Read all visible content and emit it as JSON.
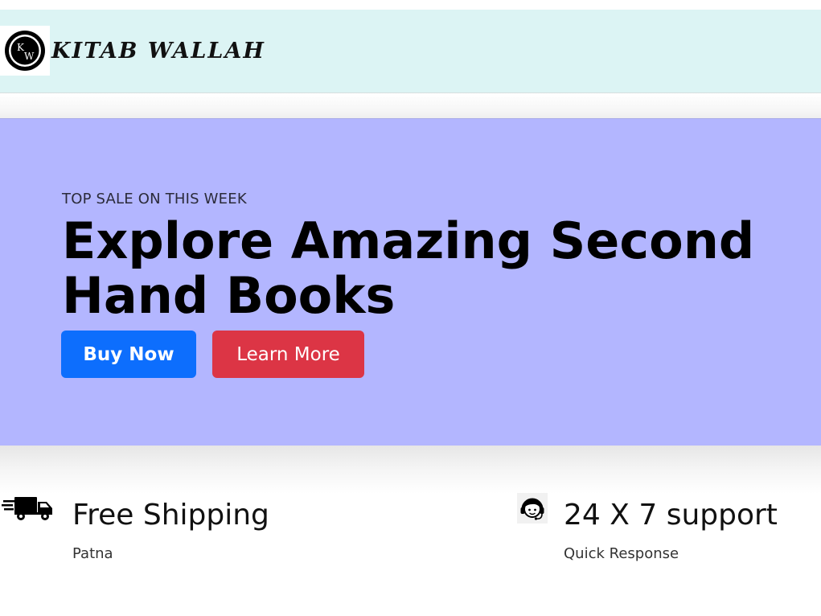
{
  "brand": {
    "name": "KITAB WALLAH",
    "logo_letters": [
      "K",
      "W"
    ]
  },
  "hero": {
    "kicker": "TOP SALE ON THIS WEEK",
    "title": "Explore Amazing Second Hand Books",
    "buttons": {
      "buy_label": "Buy Now",
      "learn_label": "Learn More"
    },
    "background": "#b3b6ff"
  },
  "features": [
    {
      "icon": "delivery-truck-icon",
      "title": "Free Shipping",
      "subtitle": "Patna"
    },
    {
      "icon": "support-agent-icon",
      "title": "24 X 7 support",
      "subtitle": "Quick Response"
    }
  ],
  "colors": {
    "navbar_bg": "#dcf4f4",
    "primary": "#0d6efd",
    "danger": "#dc3545"
  }
}
